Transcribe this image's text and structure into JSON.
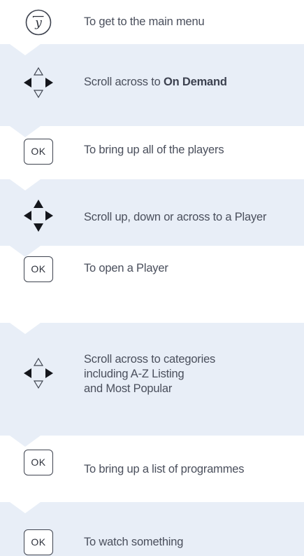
{
  "steps": [
    {
      "icon": "y-button-icon",
      "text": "To get to the main menu"
    },
    {
      "icon": "dpad-left-right-icon",
      "text_prefix": "Scroll across to ",
      "text_bold": "On Demand"
    },
    {
      "icon": "ok-button-icon",
      "icon_label": "OK",
      "text": "To bring up all of the players"
    },
    {
      "icon": "dpad-all-icon",
      "text": "Scroll up, down or across to a Player"
    },
    {
      "icon": "ok-button-icon",
      "icon_label": "OK",
      "text": "To open a Player"
    },
    {
      "icon": "dpad-left-right-icon",
      "lines": [
        "Scroll across to categories",
        "including A-Z Listing",
        "and Most Popular"
      ]
    },
    {
      "icon": "ok-button-icon",
      "icon_label": "OK",
      "text": "To bring up a list of programmes"
    },
    {
      "icon": "ok-button-icon",
      "icon_label": "OK",
      "text": "To watch something"
    }
  ],
  "colors": {
    "band_blue": "#e8eef7",
    "text": "#4a4f5c",
    "icon_stroke": "#3f4450"
  }
}
